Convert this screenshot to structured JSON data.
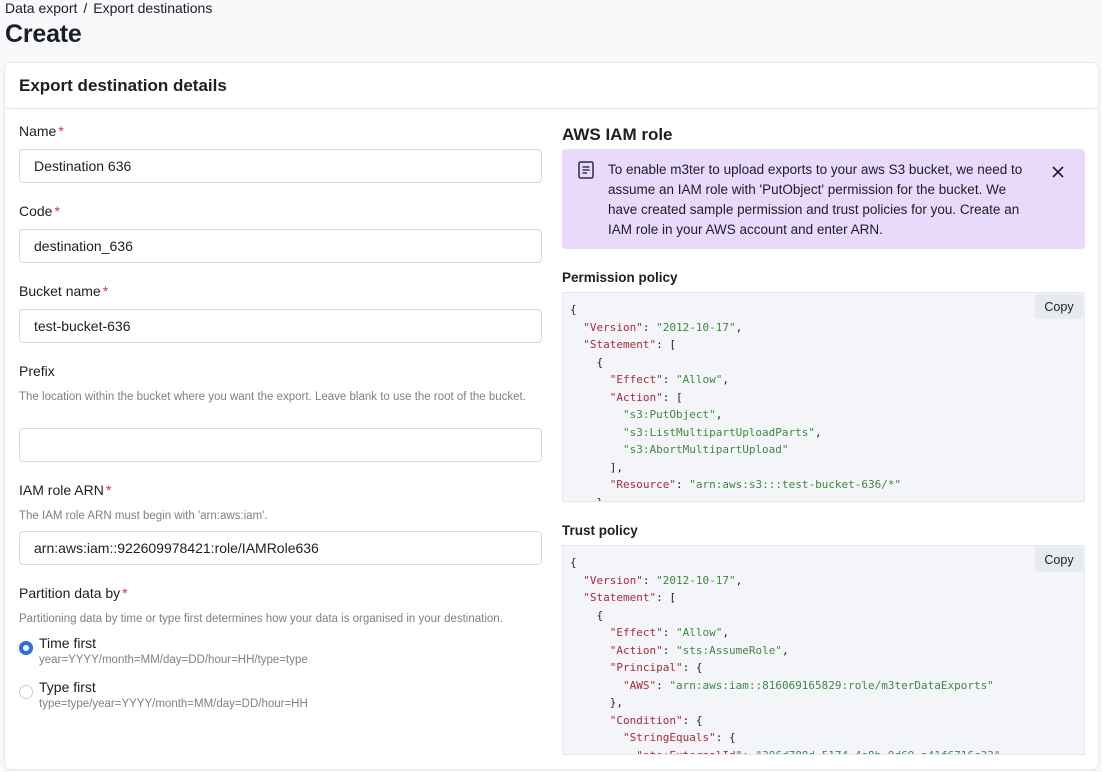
{
  "breadcrumb": {
    "items": [
      "Data export",
      "Export destinations"
    ],
    "separator": "/"
  },
  "page": {
    "title": "Create"
  },
  "card": {
    "title": "Export destination details"
  },
  "form": {
    "name": {
      "label": "Name",
      "value": "Destination 636",
      "required": true
    },
    "code": {
      "label": "Code",
      "value": "destination_636",
      "required": true
    },
    "bucket": {
      "label": "Bucket name",
      "value": "test-bucket-636",
      "required": true
    },
    "prefix": {
      "label": "Prefix",
      "help": "The location within the bucket where you want the export. Leave blank to use the root of the bucket.",
      "value": ""
    },
    "iam": {
      "label": "IAM role ARN",
      "help": "The IAM role ARN must begin with 'arn:aws:iam'.",
      "value": "arn:aws:iam::922609978421:role/IAMRole636",
      "required": true
    },
    "partition": {
      "label": "Partition data by",
      "help": "Partitioning data by time or type first determines how your data is organised in your destination.",
      "options": [
        {
          "title": "Time first",
          "sub": "year=YYYY/month=MM/day=DD/hour=HH/type=type",
          "checked": true
        },
        {
          "title": "Type first",
          "sub": "type=type/year=YYYY/month=MM/day=DD/hour=HH",
          "checked": false
        }
      ]
    },
    "required_marker": "*"
  },
  "aws": {
    "title": "AWS IAM role",
    "alert": {
      "icon": "document-icon",
      "text": "To enable m3ter to upload exports to your aws S3 bucket, we need to assume an IAM role with 'PutObject' permission for the bucket. We have created sample permission and trust policies for you. Create an IAM role in your AWS account and enter ARN.",
      "close_icon": "close-icon"
    },
    "permission": {
      "label": "Permission policy",
      "copy_label": "Copy",
      "lines": [
        "{",
        "  \"Version\": \"2012-10-17\",",
        "  \"Statement\": [",
        "    {",
        "      \"Effect\": \"Allow\",",
        "      \"Action\": [",
        "        \"s3:PutObject\",",
        "        \"s3:ListMultipartUploadParts\",",
        "        \"s3:AbortMultipartUpload\"",
        "      ],",
        "      \"Resource\": \"arn:aws:s3:::test-bucket-636/*\"",
        "    }"
      ]
    },
    "trust": {
      "label": "Trust policy",
      "copy_label": "Copy",
      "lines": [
        "{",
        "  \"Version\": \"2012-10-17\",",
        "  \"Statement\": [",
        "    {",
        "      \"Effect\": \"Allow\",",
        "      \"Action\": \"sts:AssumeRole\",",
        "      \"Principal\": {",
        "        \"AWS\": \"arn:aws:iam::816069165829:role/m3terDataExports\"",
        "      },",
        "      \"Condition\": {",
        "        \"StringEquals\": {",
        "          \"sts:ExternalId\": \"396d788d-5174-4e8b-9d69-a41f6716c33\""
      ]
    }
  },
  "colors": {
    "accent": "#2f6fd6",
    "required": "#d9363e",
    "alert_bg": "#e9d9fb",
    "json_key": "#b3293a",
    "json_string": "#3d8a3f"
  }
}
